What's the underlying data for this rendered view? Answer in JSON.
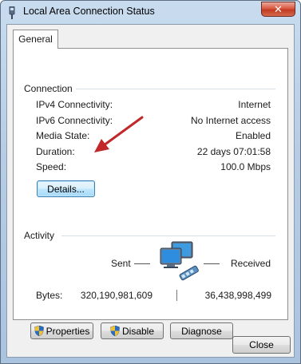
{
  "window": {
    "title": "Local Area Connection Status",
    "close_glyph": "✕"
  },
  "tabs": [
    {
      "label": "General",
      "selected": true
    }
  ],
  "connection": {
    "heading": "Connection",
    "rows": [
      {
        "label": "IPv4 Connectivity:",
        "value": "Internet"
      },
      {
        "label": "IPv6 Connectivity:",
        "value": "No Internet access"
      },
      {
        "label": "Media State:",
        "value": "Enabled"
      },
      {
        "label": "Duration:",
        "value": "22 days 07:01:58"
      },
      {
        "label": "Speed:",
        "value": "100.0 Mbps"
      }
    ],
    "details_label": "Details..."
  },
  "activity": {
    "heading": "Activity",
    "sent_label": "Sent",
    "received_label": "Received",
    "bytes_label": "Bytes:",
    "bytes_sent": "320,190,981,609",
    "bytes_received": "36,438,998,499"
  },
  "actions": {
    "properties_label": "Properties",
    "disable_label": "Disable",
    "diagnose_label": "Diagnose"
  },
  "footer": {
    "close_label": "Close"
  },
  "icons": {
    "title": "network-adapter-icon",
    "network": "network-computers-icon",
    "uac": "uac-shield-icon",
    "annotation": "red-arrow-annotation"
  },
  "colors": {
    "accent": "#3c7fb1",
    "close_button": "#c23b23",
    "arrow": "#c0282a"
  }
}
